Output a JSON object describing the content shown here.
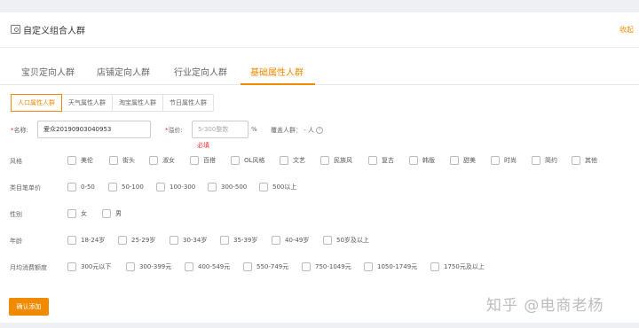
{
  "header": {
    "title": "自定义组合人群",
    "collapse": "收起"
  },
  "tabs": [
    {
      "label": "宝贝定向人群"
    },
    {
      "label": "店铺定向人群"
    },
    {
      "label": "行业定向人群"
    },
    {
      "label": "基础属性人群",
      "active": true
    }
  ],
  "subtabs": [
    "人口属性人群",
    "天气属性人群",
    "淘宝属性人群",
    "节日属性人群"
  ],
  "form": {
    "name_label": "名称:",
    "name_value": "爱众20190903040953",
    "bid_label": "溢价:",
    "bid_placeholder": "5-300整数",
    "bid_unit": "%",
    "bid_error": "必填",
    "coverage_label": "覆盖人群：",
    "coverage_value": "- 人"
  },
  "rows": [
    {
      "label": "风格",
      "options": [
        "美伦",
        "街头",
        "淑女",
        "百搭",
        "OL风格",
        "文艺",
        "民族风",
        "复古",
        "韩版",
        "甜美",
        "时尚",
        "简约",
        "其他"
      ]
    },
    {
      "label": "类目笔单价",
      "options": [
        "0-50",
        "50-100",
        "100-300",
        "300-500",
        "500以上"
      ]
    },
    {
      "label": "性别",
      "options": [
        "女",
        "男"
      ]
    },
    {
      "label": "年龄",
      "options": [
        "18-24岁",
        "25-29岁",
        "30-34岁",
        "35-39岁",
        "40-49岁",
        "50岁及以上"
      ]
    },
    {
      "label": "月均消费额度",
      "options": [
        "300元以下",
        "300-399元",
        "400-549元",
        "550-749元",
        "750-1049元",
        "1050-1749元",
        "1750元及以上"
      ]
    }
  ],
  "confirm_label": "确认添加",
  "watermark": "知乎 @电商老杨",
  "colors": {
    "accent": "#f08a00",
    "error": "#e33333"
  }
}
